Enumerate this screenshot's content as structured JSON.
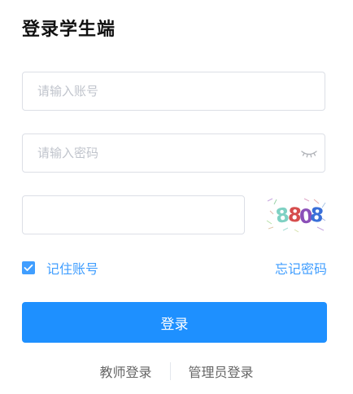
{
  "title": "登录学生端",
  "account": {
    "placeholder": "请输入账号",
    "value": ""
  },
  "password": {
    "placeholder": "请输入密码",
    "value": "",
    "toggle_icon": "eye-closed-icon"
  },
  "captcha": {
    "placeholder": "",
    "value": "",
    "image_text": "8808"
  },
  "remember": {
    "label": "记住账号",
    "checked": true
  },
  "forgot_label": "忘记密码",
  "login_label": "登录",
  "role_links": {
    "teacher": "教师登录",
    "admin": "管理员登录"
  },
  "colors": {
    "accent": "#409eff",
    "button": "#1e90ff",
    "title": "#111111",
    "placeholder": "#c0c4cc"
  }
}
